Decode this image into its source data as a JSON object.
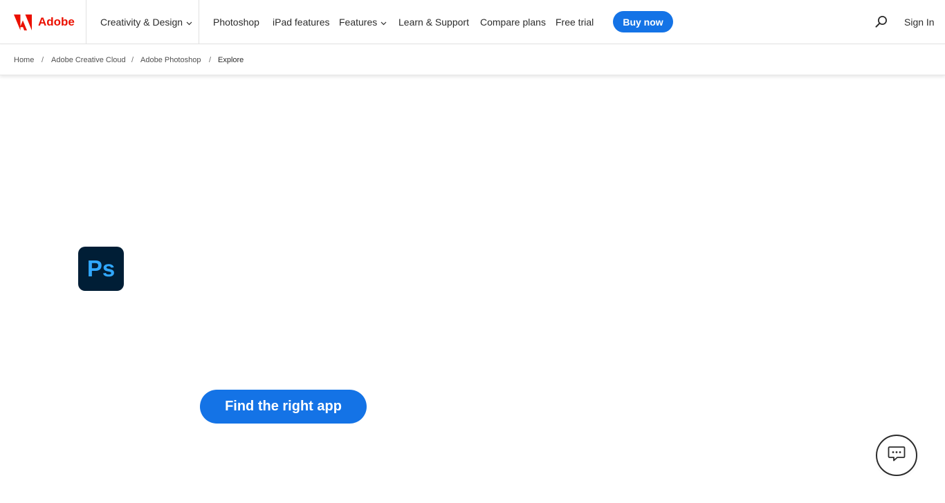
{
  "header": {
    "brand_name": "Adobe",
    "brand_color": "#eb1000",
    "nav": {
      "creativity": "Creativity & Design",
      "photoshop": "Photoshop",
      "ipad": "iPad features",
      "features": "Features",
      "learn": "Learn & Support",
      "compare": "Compare plans",
      "trial": "Free trial",
      "buy": "Buy now",
      "sign_in": "Sign In"
    },
    "accent_color": "#1473e6"
  },
  "breadcrumb": {
    "items": [
      "Home",
      "Adobe Creative Cloud",
      "Adobe Photoshop",
      "Explore"
    ],
    "separator": "/"
  },
  "hero": {
    "app_logo_text": "Ps",
    "cta_label": "Find the right app"
  },
  "icons": {
    "brand": "adobe-logo-icon",
    "dropdown": "chevron-down-icon",
    "search": "search-icon",
    "chat": "chat-icon"
  }
}
